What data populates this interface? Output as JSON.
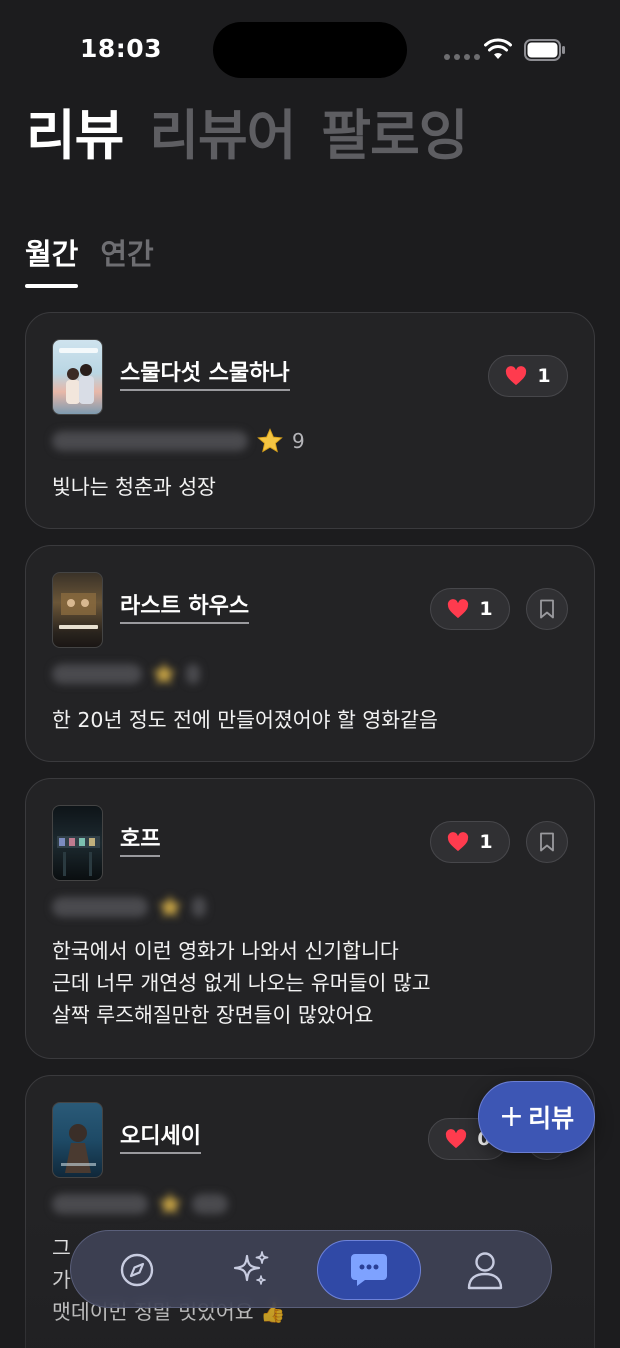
{
  "status_bar": {
    "time": "18:03"
  },
  "header": {
    "tabs": [
      {
        "label": "리뷰",
        "active": true
      },
      {
        "label": "리뷰어",
        "active": false
      },
      {
        "label": "팔로잉",
        "active": false
      }
    ]
  },
  "period_tabs": [
    {
      "label": "월간",
      "active": true
    },
    {
      "label": "연간",
      "active": false
    }
  ],
  "reviews": [
    {
      "title": "스물다섯 스물하나",
      "likes": "1",
      "rating": "9",
      "text": "빛나는 청춘과 성장",
      "bookmark": false
    },
    {
      "title": "라스트 하우스",
      "likes": "1",
      "rating": "",
      "text": "한 20년 정도 전에 만들어졌어야 할 영화같음",
      "bookmark": true
    },
    {
      "title": "호프",
      "likes": "1",
      "rating": "",
      "text": "한국에서 이런 영화가 나와서 신기합니다\n근데 너무 개연성 없게 나오는 유머들이 많고\n살짝 루즈해질만한 장면들이 많았어요",
      "bookmark": true
    },
    {
      "title": "오디세이",
      "likes": "0",
      "rating": "",
      "text": "그\n가\n맷데이먼 정말 멋있어요 👍",
      "bookmark": true
    }
  ],
  "fab": {
    "plus": "+",
    "label": "리뷰"
  },
  "bottom_nav": {
    "items": [
      {
        "icon": "compass-icon",
        "active": false
      },
      {
        "icon": "sparkles-icon",
        "active": false
      },
      {
        "icon": "chat-bubble-icon",
        "active": true
      },
      {
        "icon": "person-icon",
        "active": false
      }
    ]
  },
  "colors": {
    "background": "#1c1c1e",
    "card": "#232325",
    "accent": "#3d56b4",
    "heart": "#ff3b4e",
    "star": "#f5c542"
  }
}
